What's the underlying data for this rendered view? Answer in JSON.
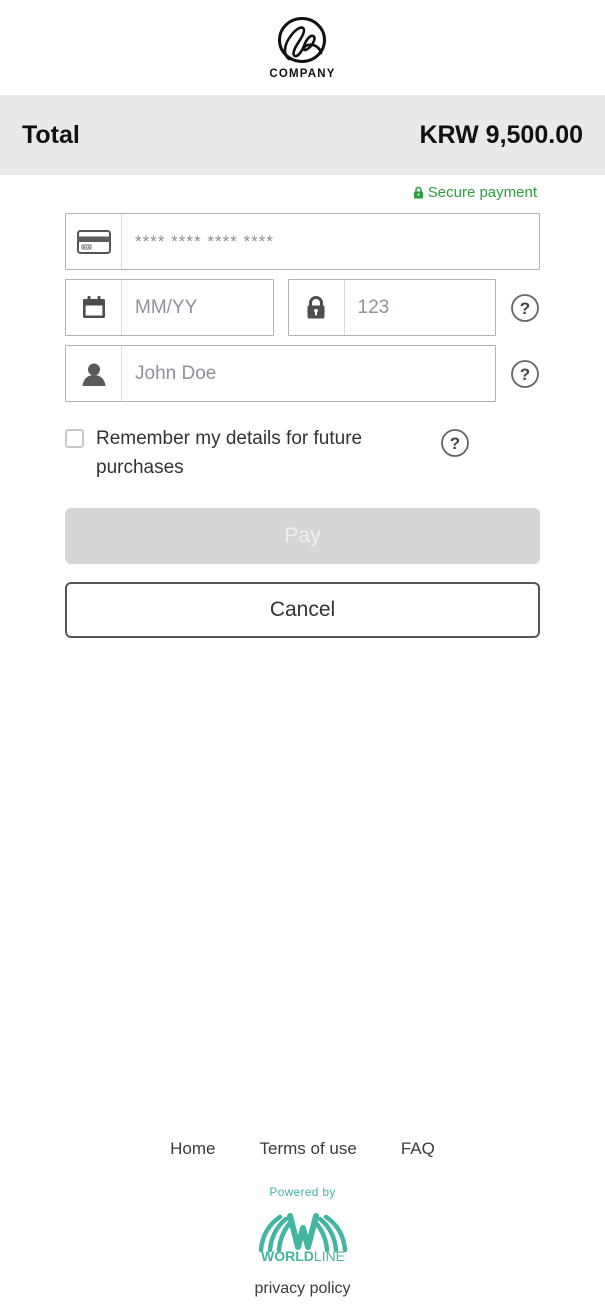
{
  "merchant": {
    "logo_icon": "company-monogram-icon",
    "name": "COMPANY"
  },
  "summary": {
    "total_label": "Total",
    "total_amount": "KRW 9,500.00"
  },
  "security": {
    "lock_icon": "lock-icon",
    "text": "Secure payment",
    "color": "#2e9e3e"
  },
  "form": {
    "card_number": {
      "icon": "credit-card-icon",
      "placeholder": "**** **** **** ****",
      "value": ""
    },
    "expiry": {
      "icon": "calendar-icon",
      "placeholder": "MM/YY",
      "value": ""
    },
    "cvv": {
      "icon": "padlock-icon",
      "placeholder": "123",
      "value": "",
      "help_icon": "question-mark-icon"
    },
    "cardholder": {
      "icon": "person-icon",
      "placeholder": "John Doe",
      "value": "",
      "help_icon": "question-mark-icon"
    },
    "remember": {
      "checked": false,
      "label": "Remember my details for future purchases",
      "help_icon": "question-mark-icon"
    }
  },
  "actions": {
    "pay_label": "Pay",
    "pay_disabled": true,
    "cancel_label": "Cancel"
  },
  "footer": {
    "links": [
      {
        "label": "Home"
      },
      {
        "label": "Terms of use"
      },
      {
        "label": "FAQ"
      }
    ],
    "powered_by": "Powered by",
    "provider_name_bold": "WORLD",
    "provider_name_light": "LINE",
    "provider_logo_icon": "worldline-fan-icon",
    "provider_color": "#45b5a3",
    "privacy_policy": "privacy policy"
  }
}
